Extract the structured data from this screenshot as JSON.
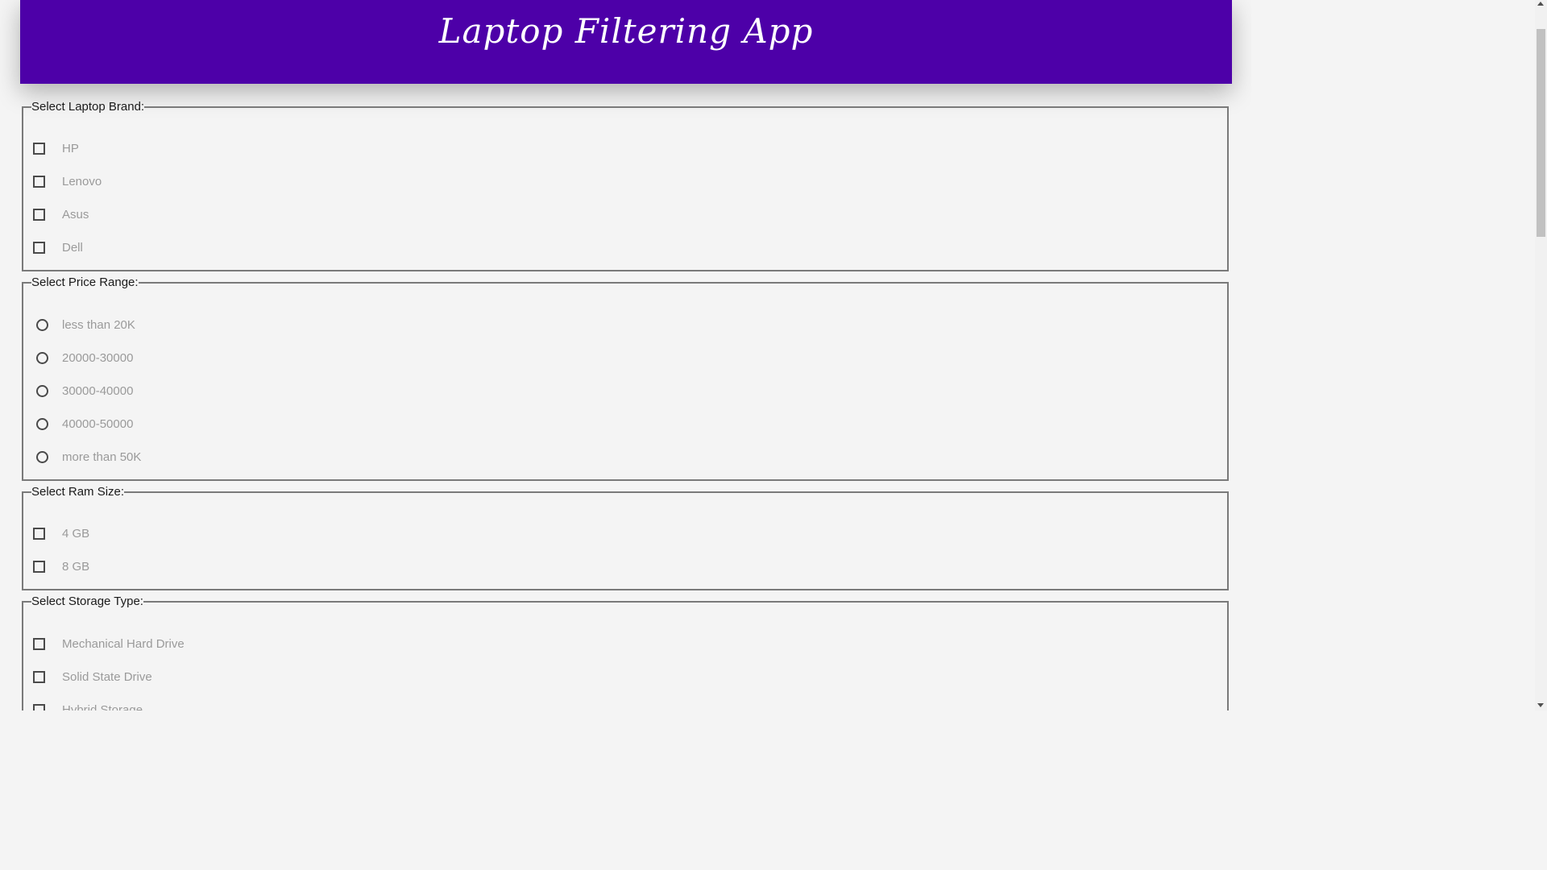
{
  "header": {
    "title": "Laptop Filtering App",
    "background": "#4d00a8"
  },
  "brand": {
    "legend": "Select Laptop Brand:",
    "options": [
      "HP",
      "Lenovo",
      "Asus",
      "Dell"
    ]
  },
  "price": {
    "legend": "Select Price Range:",
    "options": [
      "less than 20K",
      "20000-30000",
      "30000-40000",
      "40000-50000",
      "more than 50K"
    ]
  },
  "ram": {
    "legend": "Select Ram Size:",
    "options": [
      "4 GB",
      "8 GB"
    ]
  },
  "storage": {
    "legend": "Select Storage Type:",
    "options": [
      "Mechanical Hard Drive",
      "Solid State Drive",
      "Hybrid Storage"
    ]
  }
}
